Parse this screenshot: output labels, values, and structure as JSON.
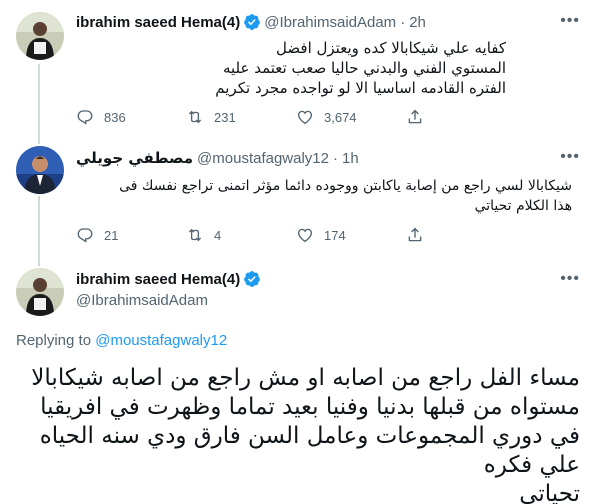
{
  "tweet1": {
    "name": "ibrahim saeed Hema(4)",
    "handle": "@IbrahimsaidAdam",
    "dot": "·",
    "time": "2h",
    "lines": [
      "كفايه علي شيكابالا كده ويعتزل افضل",
      "المستوي الفني والبدني حاليا صعب تعتمد عليه",
      "الفتره القادمه اساسيا الا لو تواجده مجرد تكريم"
    ],
    "replies": "836",
    "retweets": "231",
    "likes": "3,674"
  },
  "tweet2": {
    "name": "مصطفي جويلي",
    "handle": "@moustafagwaly12",
    "dot": "·",
    "time": "1h",
    "lines": [
      "شيكابالا لسي راجع من إصابة ياكابتن ووجوده دائما مؤثر اتمنى تراجع نفسك فى",
      "هذا الكلام تحياتي"
    ],
    "replies": "21",
    "retweets": "4",
    "likes": "174"
  },
  "tweet3": {
    "name": "ibrahim saeed Hema(4)",
    "handle": "@IbrahimsaidAdam",
    "replying_prefix": "Replying to",
    "replying_to": "@moustafagwaly12",
    "lines": [
      "مساء الفل راجع من اصابه او مش راجع من اصابه شيكابالا",
      "مستواه من قبلها بدنيا وفنيا بعيد تماما وظهرت في افريقيا",
      "في دوري المجموعات وعامل السن فارق ودي سنه الحياه",
      "علي فكره",
      "تحياتي"
    ]
  },
  "colors": {
    "accent": "#1d9bf0",
    "muted": "#536471",
    "text": "#0f1419"
  },
  "icons": [
    "verified-badge-icon",
    "more-icon",
    "reply-icon",
    "retweet-icon",
    "like-icon",
    "share-icon"
  ]
}
